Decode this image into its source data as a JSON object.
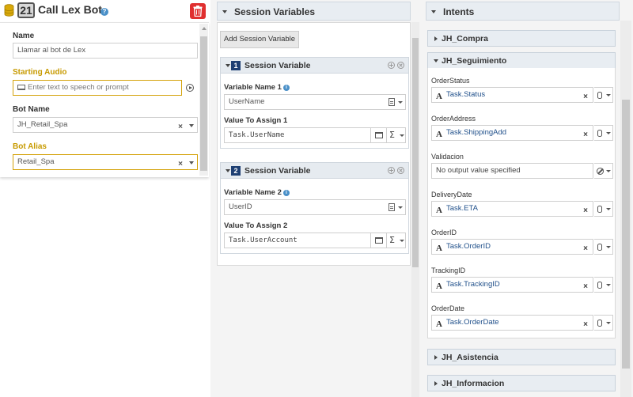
{
  "node": {
    "number": "21",
    "title": "Call Lex Bot",
    "help": "?"
  },
  "fields": {
    "name_label": "Name",
    "name_value": "Llamar al bot de Lex",
    "audio_label": "Starting Audio",
    "audio_placeholder": "Enter text to speech or prompt",
    "botname_label": "Bot Name",
    "botname_value": "JH_Retail_Spa",
    "botalias_label": "Bot Alias",
    "botalias_value": "Retail_Spa",
    "clear": "×"
  },
  "session": {
    "title": "Session Variables",
    "add_button": "Add Session Variable",
    "items": [
      {
        "num": "1",
        "title": "Session Variable",
        "var_label": "Variable Name 1",
        "var_value": "UserName",
        "assign_label": "Value To Assign 1",
        "assign_value": "Task.UserName"
      },
      {
        "num": "2",
        "title": "Session Variable",
        "var_label": "Variable Name 2",
        "var_value": "UserID",
        "assign_label": "Value To Assign 2",
        "assign_value": "Task.UserAccount"
      }
    ],
    "sigma": "Σ",
    "info": "i"
  },
  "intents": {
    "title": "Intents",
    "compra": "JH_Compra",
    "seguimiento": "JH_Seguimiento",
    "asistencia": "JH_Asistencia",
    "informacion": "JH_Informacion",
    "type_glyph": "A",
    "clear": "×",
    "slots": [
      {
        "label": "OrderStatus",
        "value": "Task.Status"
      },
      {
        "label": "OrderAddress",
        "value": "Task.ShippingAdd"
      },
      {
        "label": "Validacion",
        "value": "No output value specified"
      },
      {
        "label": "DeliveryDate",
        "value": "Task.ETA"
      },
      {
        "label": "OrderID",
        "value": "Task.OrderID"
      },
      {
        "label": "TrackingID",
        "value": "Task.TrackingID"
      },
      {
        "label": "OrderDate",
        "value": "Task.OrderDate"
      }
    ]
  },
  "colors": {
    "accent_yellow": "#c79a00",
    "delete_red": "#e03030",
    "badge_navy": "#1e3f73",
    "link_blue": "#1f4f8a"
  }
}
